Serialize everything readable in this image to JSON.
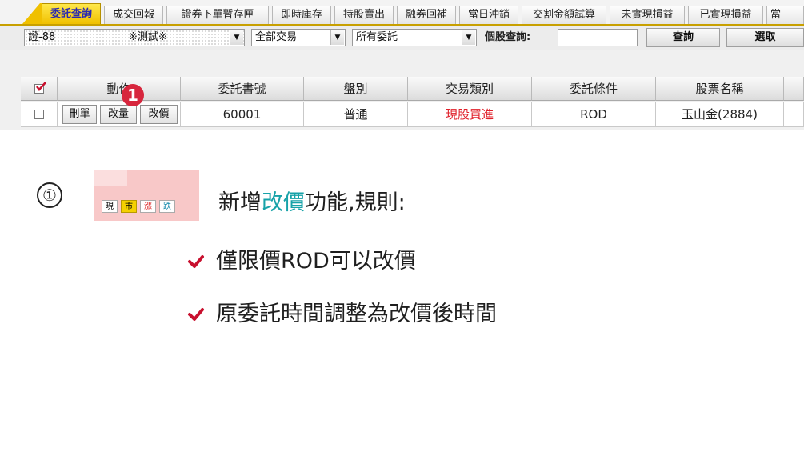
{
  "tabs": [
    "委託查詢",
    "成交回報",
    "證券下單暫存匣",
    "即時庫存",
    "持股賣出",
    "融券回補",
    "當日沖銷",
    "交割金額試算",
    "未實現損益",
    "已實現損益",
    "當"
  ],
  "toolbar": {
    "account": "證-88",
    "account_name": "※測試※",
    "trade_filter": "全部交易",
    "order_filter": "所有委託",
    "stock_query_label": "個股查詢:",
    "query_button": "查詢",
    "select_button": "選取"
  },
  "table": {
    "headers": [
      "動作",
      "委託書號",
      "盤別",
      "交易類別",
      "委託條件",
      "股票名稱"
    ],
    "row": {
      "actions": [
        "刪單",
        "改量",
        "改價"
      ],
      "order_no": "60001",
      "session": "普通",
      "trade_type": "現股買進",
      "condition": "ROD",
      "stock": "玉山金(2884)"
    },
    "marker": "1"
  },
  "notes": {
    "number": "①",
    "chips": [
      "現",
      "市",
      "漲",
      "跌"
    ],
    "intro_prefix": "新增",
    "intro_highlight": "改價",
    "intro_suffix": "功能,規則:",
    "rules": [
      "僅限價ROD可以改價",
      "原委託時間調整為改價後時間"
    ]
  },
  "colors": {
    "accent_teal": "#17a2a8",
    "marker_red": "#d7263d",
    "tab_active": "#f0c000",
    "check_red": "#c8102e"
  }
}
